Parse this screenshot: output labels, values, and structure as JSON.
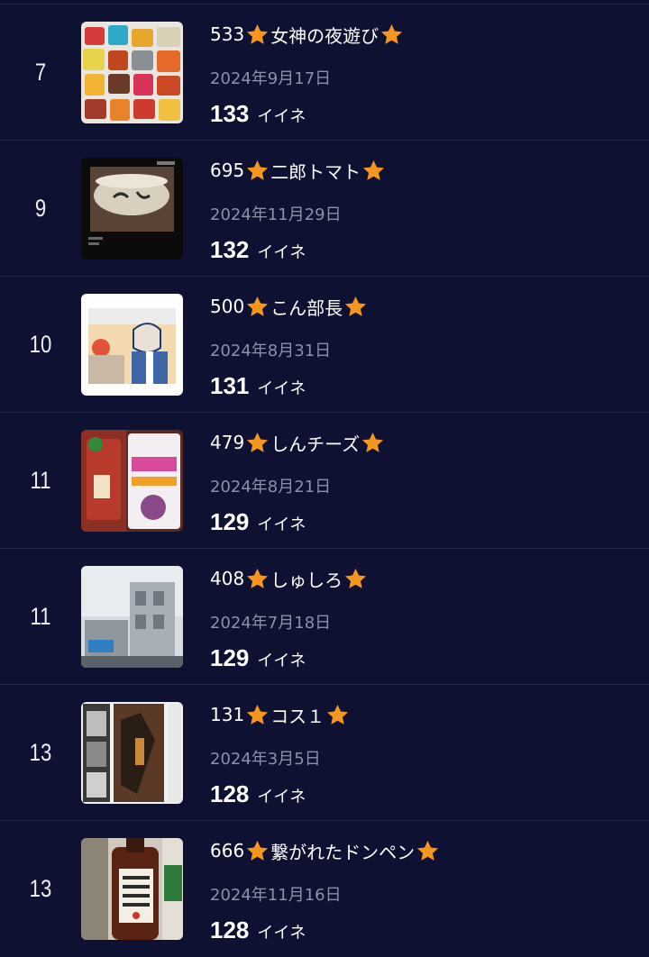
{
  "ranking": {
    "like_unit": "イイネ",
    "star_color": "#f5961f",
    "background_color": "#0e1131",
    "items": [
      {
        "rank": "7",
        "number": "533",
        "name": "女神の夜遊び",
        "date": "2024年9月17日",
        "likes": "133",
        "thumbnail_icon": "snack-packs-photo"
      },
      {
        "rank": "9",
        "number": "695",
        "name": "二郎トマト",
        "date": "2024年11月29日",
        "likes": "132",
        "thumbnail_icon": "ramen-bowl-album-cover"
      },
      {
        "rank": "10",
        "number": "500",
        "name": "こん部長",
        "date": "2024年8月31日",
        "likes": "131",
        "thumbnail_icon": "manga-salaryman-illustration"
      },
      {
        "rank": "11",
        "number": "479",
        "name": "しんチーズ",
        "date": "2024年8月21日",
        "likes": "129",
        "thumbnail_icon": "candy-bags-photo"
      },
      {
        "rank": "11",
        "number": "408",
        "name": "しゅしろ",
        "date": "2024年7月18日",
        "likes": "129",
        "thumbnail_icon": "street-scene-photo"
      },
      {
        "rank": "13",
        "number": "131",
        "name": "コス１",
        "date": "2024年3月5日",
        "likes": "128",
        "thumbnail_icon": "costume-photo-collage"
      },
      {
        "rank": "13",
        "number": "666",
        "name": "繋がれたドンペン",
        "date": "2024年11月16日",
        "likes": "128",
        "thumbnail_icon": "bottle-label-photo"
      }
    ]
  }
}
